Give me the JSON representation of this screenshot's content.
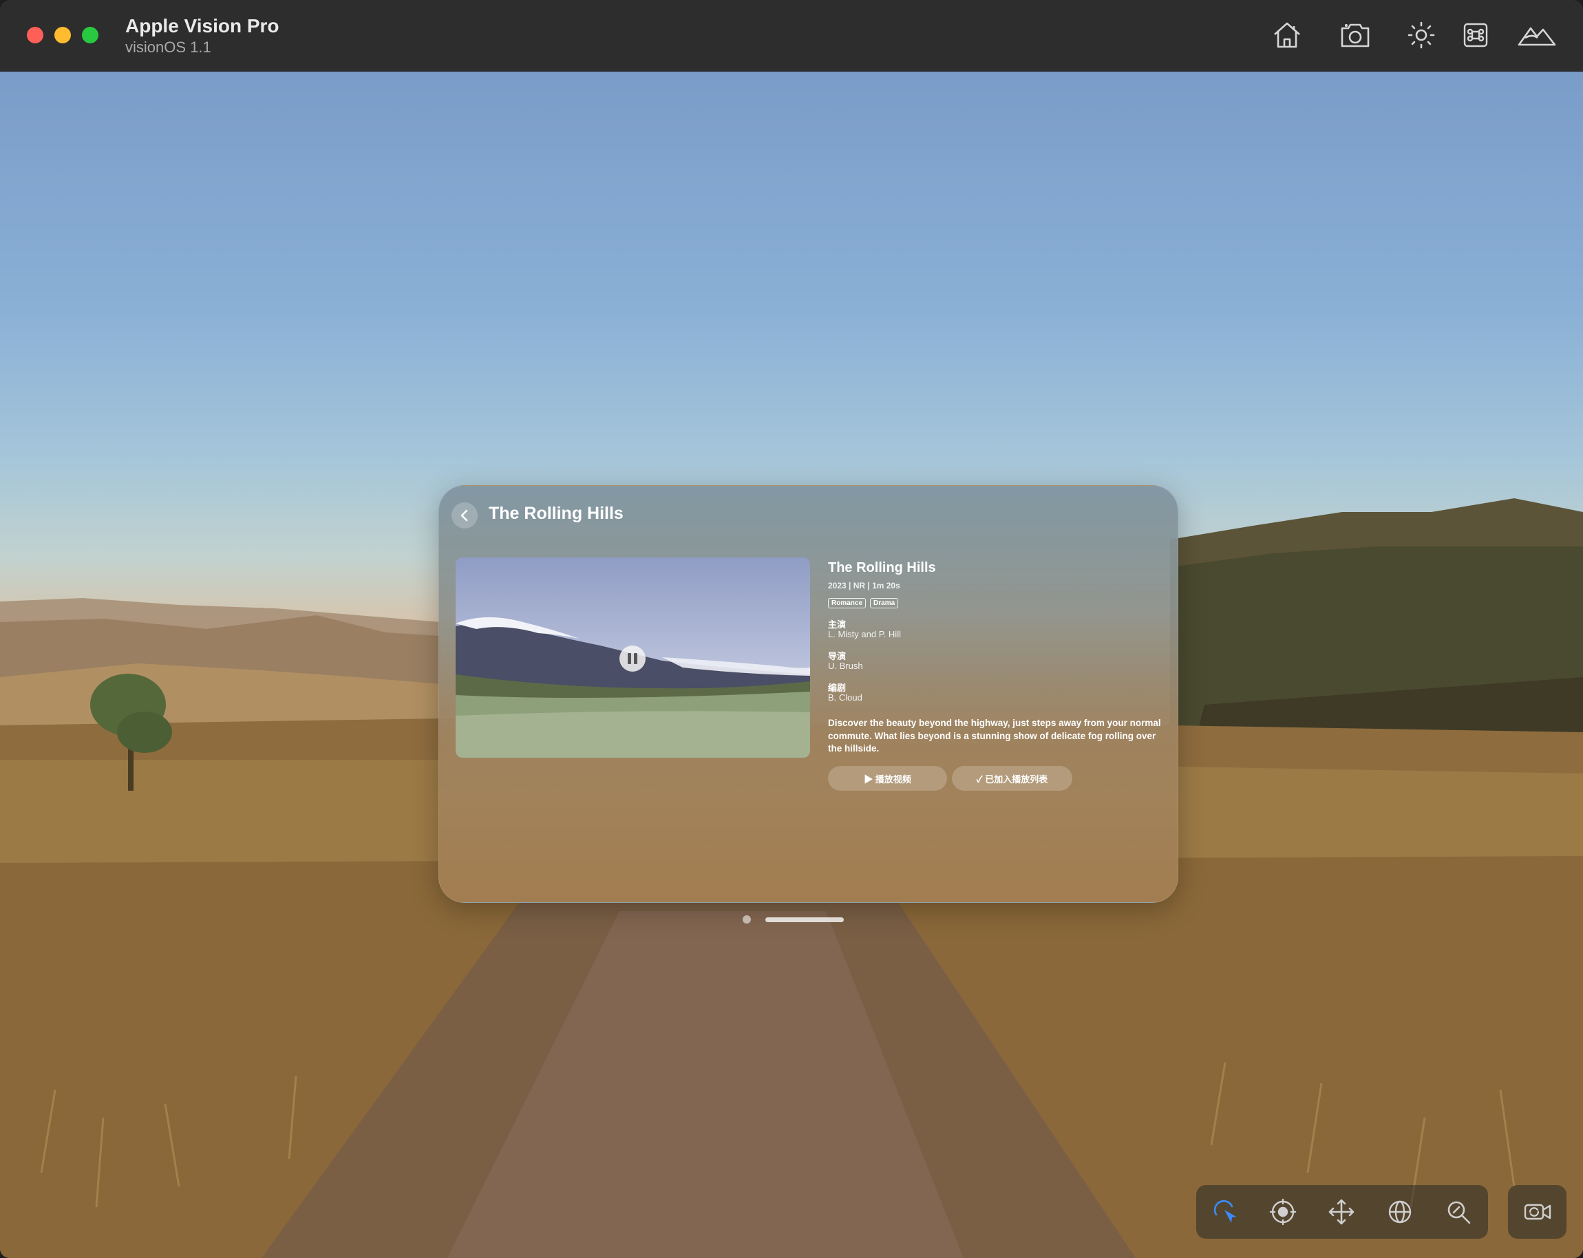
{
  "app": {
    "title": "Apple Vision Pro",
    "subtitle": "visionOS 1.1"
  },
  "titlebar_icons": [
    "home-icon",
    "screenshot-camera-icon",
    "brightness-icon",
    "command-key-icon",
    "environment-mountains-icon"
  ],
  "panel": {
    "header_title": "The Rolling Hills",
    "video": {
      "state": "playing",
      "control": "pause-icon"
    },
    "movie": {
      "title": "The Rolling Hills",
      "meta": "2023 | NR | 1m 20s",
      "tags": [
        "Romance",
        "Drama"
      ],
      "credits": [
        {
          "label": "主演",
          "value": "L. Misty and P. Hill"
        },
        {
          "label": "导演",
          "value": "U. Brush"
        },
        {
          "label": "编剧",
          "value": "B. Cloud"
        }
      ],
      "description": "Discover the beauty beyond the highway, just steps away from your normal commute. What lies beyond is a stunning show of delicate fog rolling over the hillside."
    },
    "buttons": {
      "play": "▶ 播放视频",
      "playlist": "✓ 已加入播放列表"
    }
  },
  "toolbar": {
    "tools": [
      "select-pointer-icon",
      "look-around-icon",
      "pan-move-icon",
      "orbit-icon",
      "zoom-icon"
    ],
    "active_tool": "select-pointer-icon",
    "accent": "#3a8cff",
    "camera": "camera-switch-icon"
  }
}
